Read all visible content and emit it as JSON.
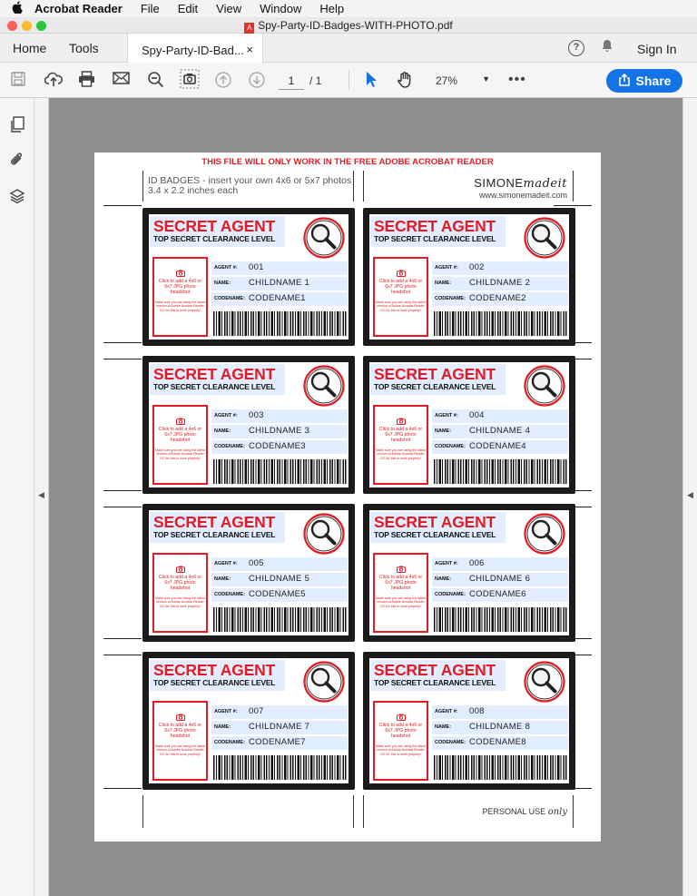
{
  "menubar": {
    "apple": "",
    "app": "Acrobat Reader",
    "items": [
      "File",
      "Edit",
      "View",
      "Window",
      "Help"
    ]
  },
  "window": {
    "title": "Spy-Party-ID-Badges-WITH-PHOTO.pdf"
  },
  "tabs": {
    "home": "Home",
    "tools": "Tools",
    "document": "Spy-Party-ID-Bad...",
    "close": "×",
    "help": "?",
    "sign_in": "Sign In"
  },
  "toolbar": {
    "page_current": "1",
    "page_total": "/ 1",
    "zoom": "27%",
    "more": "•••",
    "share": "Share"
  },
  "colors": {
    "accent": "#1473e6",
    "badge_red": "#e41b23",
    "badge_blue": "#e2eeff",
    "badge_frame": "#1b1b1b"
  },
  "document": {
    "warning": "THIS FILE WILL ONLY WORK IN THE FREE ADOBE ACROBAT READER",
    "header_line1": "ID BADGES - insert your own 4x6 or 5x7 photos",
    "header_line2": "3.4 x 2.2 inches each",
    "brand_main": "SIMONE",
    "brand_script": "madeit",
    "brand_url": "www.simonemadeit.com",
    "footer_main": "PERSONAL USE",
    "footer_script": "only"
  },
  "badge_template": {
    "title": "SECRET AGENT",
    "subtitle": "TOP SECRET CLEARANCE LEVEL",
    "photo_icon": "camera-icon",
    "photo_text": "Click to add a 4x6 or 6x7 JPG photo headshot",
    "photo_small": "Make sure you are using the latest version of Adobe Acrobat Reader DC for this to work properly!",
    "label_agent": "AGENT #:",
    "label_name": "NAME:",
    "label_codename": "CODENAME:"
  },
  "badges": [
    {
      "agent": "001",
      "name": "CHILDNAME 1",
      "codename": "CODENAME1"
    },
    {
      "agent": "002",
      "name": "CHILDNAME 2",
      "codename": "CODENAME2"
    },
    {
      "agent": "003",
      "name": "CHILDNAME 3",
      "codename": "CODENAME3"
    },
    {
      "agent": "004",
      "name": "CHILDNAME 4",
      "codename": "CODENAME4"
    },
    {
      "agent": "005",
      "name": "CHILDNAME 5",
      "codename": "CODENAME5"
    },
    {
      "agent": "006",
      "name": "CHILDNAME 6",
      "codename": "CODENAME6"
    },
    {
      "agent": "007",
      "name": "CHILDNAME 7",
      "codename": "CODENAME7"
    },
    {
      "agent": "008",
      "name": "CHILDNAME 8",
      "codename": "CODENAME8"
    }
  ],
  "icons": [
    "apple-icon",
    "pdf-icon",
    "help-icon",
    "bell-icon",
    "save-icon",
    "upload-icon",
    "print-icon",
    "email-icon",
    "zoom-out-icon",
    "snapshot-icon",
    "prev-page-icon",
    "next-page-icon",
    "select-arrow-icon",
    "hand-icon",
    "share-icon",
    "pages-icon",
    "attachment-icon",
    "layers-icon"
  ]
}
